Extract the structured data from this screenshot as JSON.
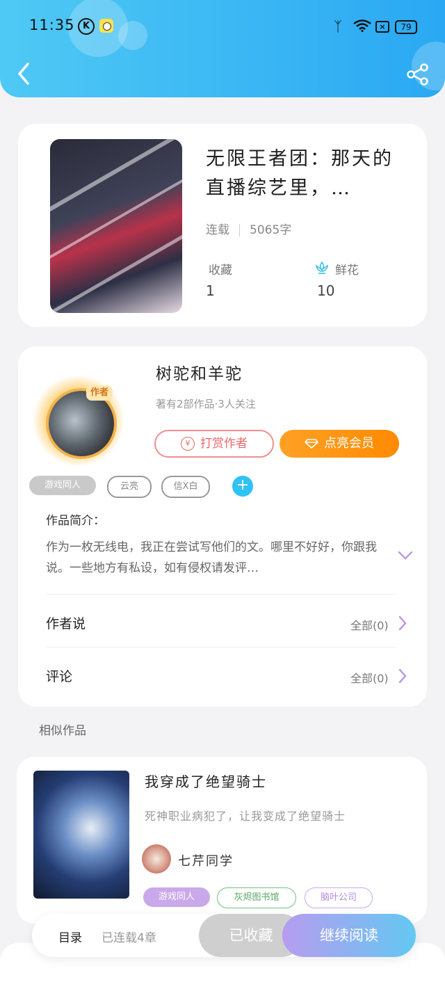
{
  "status_bar": {
    "time": "11:35",
    "k_badge": "K",
    "battery": "79"
  },
  "header": {
    "back_icon": "back-arrow-icon",
    "share_icon": "share-icon",
    "gradient": [
      "#4fc9f4",
      "#2aa8f3"
    ]
  },
  "book": {
    "title": "无限王者团：那天的直播综艺里，…",
    "status": "连载",
    "word_count": "5065字",
    "favorites_label": "收藏",
    "favorites_count": "1",
    "flowers_label": "鲜花",
    "flowers_count": "10"
  },
  "author": {
    "badge": "作者",
    "name": "树驼和羊驼",
    "subtitle": "著有2部作品·3人关注",
    "reward_label": "打赏作者",
    "vip_label": "点亮会员",
    "tags": [
      "游戏同人",
      "云亮",
      "信X白"
    ],
    "add_tag": "+"
  },
  "intro": {
    "label": "作品简介：",
    "text": "作为一枚无线电，我正在尝试写他们的文。哪里不好好，你跟我说。一些地方有私设，如有侵权请发评…"
  },
  "rows": [
    {
      "label": "作者说",
      "right": "全部(0)"
    },
    {
      "label": "评论",
      "right": "全部(0)"
    }
  ],
  "similar": {
    "section_label": "相似作品",
    "title": "我穿成了绝望骑士",
    "description": "死神职业病犯了，让我变成了绝望骑士",
    "author": "七芹同学",
    "tags": [
      "游戏同人",
      "灰烬图书馆",
      "脑叶公司"
    ]
  },
  "bottom_bar": {
    "toc": "目录",
    "chapters": "已连载4章",
    "collected": "已收藏",
    "continue": "继续阅读"
  }
}
